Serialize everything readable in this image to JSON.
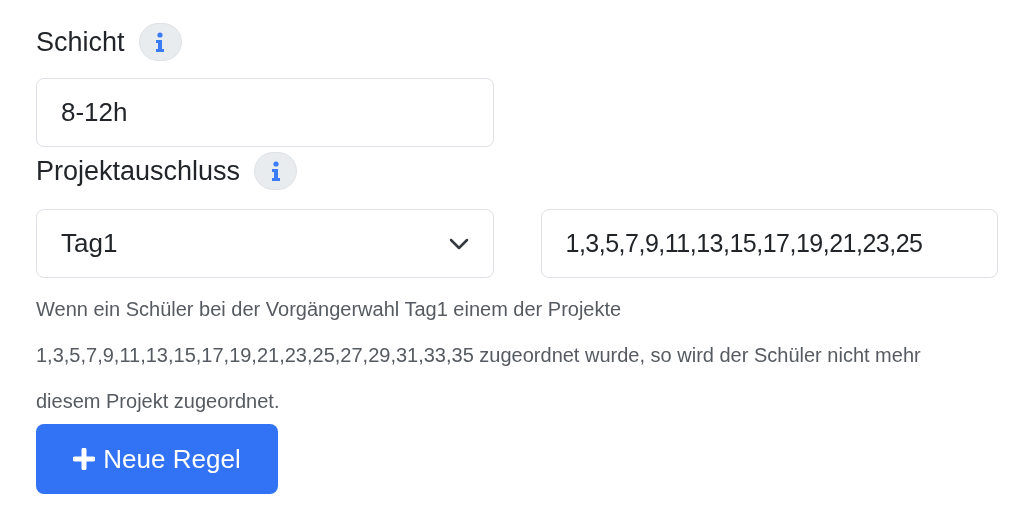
{
  "shift": {
    "label": "Schicht",
    "value": "8-12h"
  },
  "project_exclusion": {
    "label": "Projektauschluss",
    "day_select": "Tag1",
    "projects_value": "1,3,5,7,9,11,13,15,17,19,21,23,25"
  },
  "description": "Wenn ein Schüler bei der Vorgängerwahl Tag1 einem der Projekte 1,3,5,7,9,11,13,15,17,19,21,23,25,27,29,31,33,35 zugeordnet wurde, so wird der Schüler nicht mehr diesem Projekt zugeordnet.",
  "add_button": {
    "label": "Neue Regel"
  }
}
